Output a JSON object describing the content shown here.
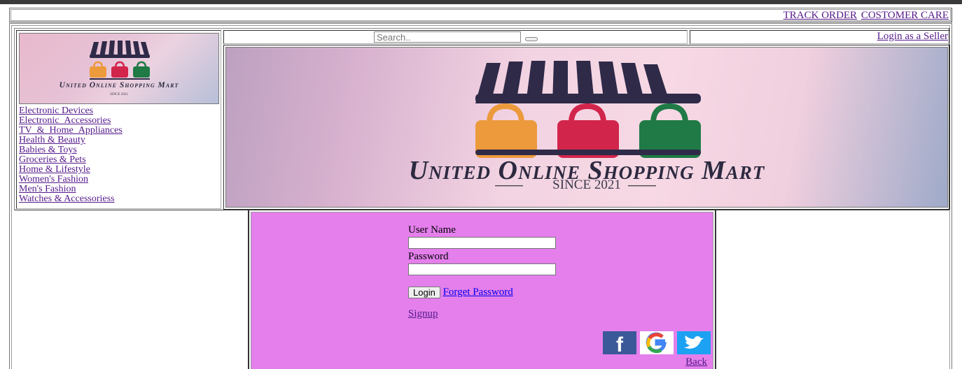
{
  "top_links": {
    "track_order": "TRACK ORDER",
    "customer_care": "COSTOMER CARE"
  },
  "brand": {
    "name_small": "United Online Shopping Mart",
    "since_small": "SINCE 2021",
    "name_large": "United Online Shopping Mart",
    "since_large": "SINCE 2021"
  },
  "categories": [
    "Electronic Devices",
    "Electronic_Accessories",
    "TV_&_Home_Appliances",
    "Health & Beauty",
    "Babies & Toys",
    "Groceries & Pets",
    "Home & Lifestyle",
    "Women's Fashion",
    "Men's Fashion",
    "Watches & Accessoriess"
  ],
  "search": {
    "placeholder": "Search.."
  },
  "seller_link": "Login as a Seller",
  "login": {
    "username_label": "User Name",
    "password_label": "Password",
    "login_button": "Login",
    "forget_password": "Forget Password",
    "signup": "Signup",
    "back": "Back"
  },
  "social_icons": [
    "facebook-icon",
    "google-icon",
    "twitter-icon"
  ],
  "colors": {
    "panel_bg": "#e47fec",
    "link_visited": "#551a8b",
    "link": "#0000ee",
    "bag_orange": "#ec9a3c",
    "bag_red": "#d2254c",
    "bag_green": "#1f7a45",
    "awning": "#2f2a48"
  }
}
